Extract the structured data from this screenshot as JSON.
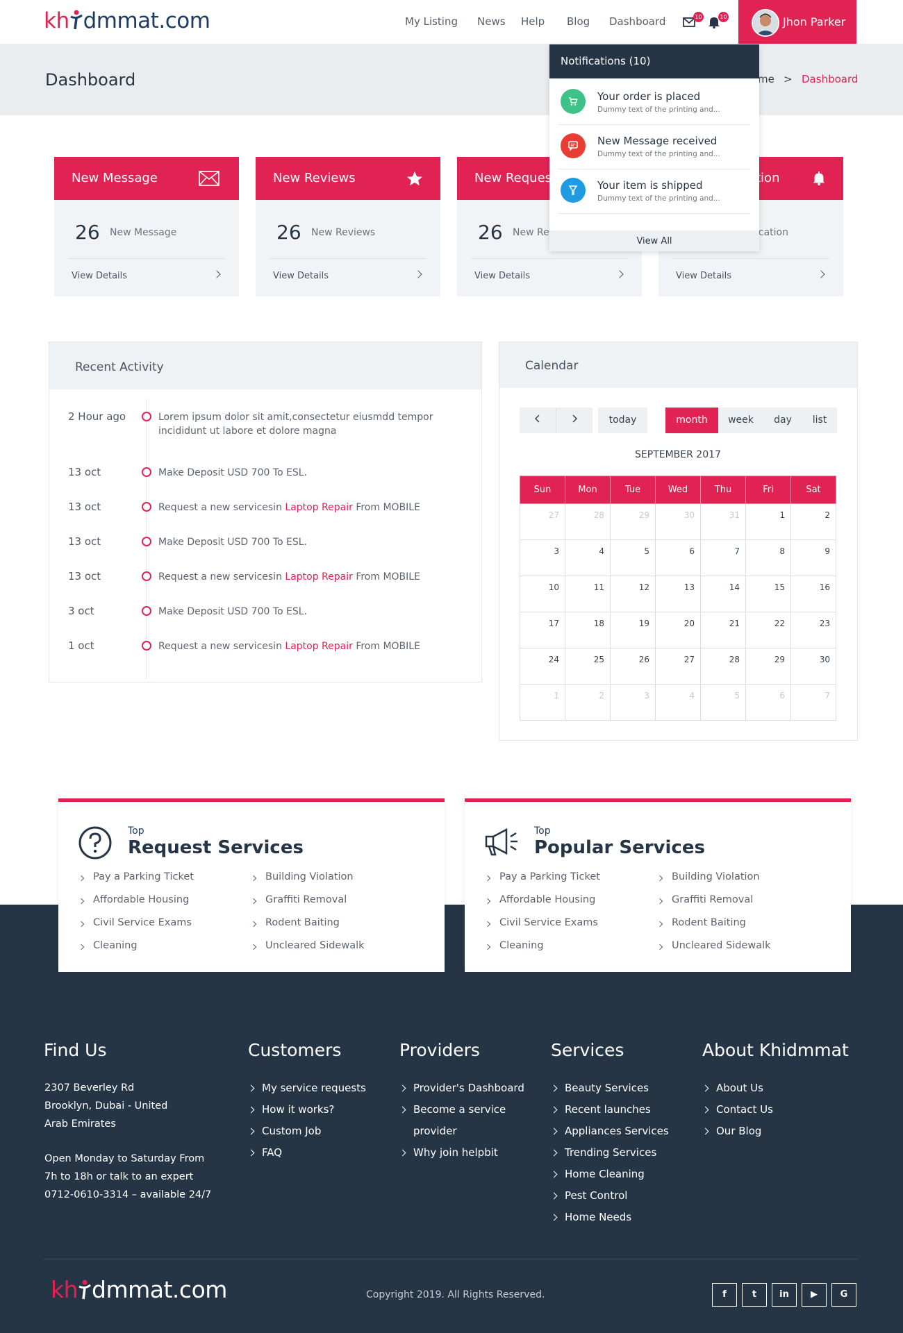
{
  "brand": {
    "logo_prefix": "kh",
    "logo_suffix": "dmmat.com"
  },
  "nav": {
    "items": [
      "My Listing",
      "News",
      "Help",
      "Blog",
      "Dashboard"
    ],
    "mail_count": "10",
    "bell_count": "10",
    "user_name": "Jhon Parker"
  },
  "page": {
    "title": "Dashboard",
    "breadcrumb_home": "me",
    "breadcrumb_sep": ">",
    "breadcrumb_current": "Dashboard"
  },
  "notifications": {
    "header": "Notifications (10)",
    "items": [
      {
        "title": "Your order is placed",
        "text": "Dummy text of the printing and...",
        "color": "#3fc287",
        "icon": "cart-icon"
      },
      {
        "title": "New Message received",
        "text": "Dummy text of the printing and...",
        "color": "#ea3b35",
        "icon": "message-icon"
      },
      {
        "title": "Your item is shipped",
        "text": "Dummy text of the printing and...",
        "color": "#1e9be3",
        "icon": "shipping-icon"
      }
    ],
    "view_all": "View All"
  },
  "cards": [
    {
      "title": "New Message",
      "count": "26",
      "label": "New Message",
      "link": "View Details",
      "icon": "envelope-icon"
    },
    {
      "title": "New Reviews",
      "count": "26",
      "label": "New Reviews",
      "link": "View Details",
      "icon": "star-icon"
    },
    {
      "title": "New Reques",
      "count": "26",
      "label": "New Re",
      "link": "View Details",
      "icon": "request-icon"
    },
    {
      "title": "tion",
      "count": "",
      "label": "ication",
      "link": "View Details",
      "icon": "bell-icon"
    }
  ],
  "activity": {
    "title": "Recent Activity",
    "items": [
      {
        "date": "2 Hour ago",
        "pre": "Lorem ipsum dolor sit amit,consectetur eiusmdd tempor incididunt ut labore et dolore magna",
        "link": "",
        "post": ""
      },
      {
        "date": "13 oct",
        "pre": "Make Deposit USD 700 To ESL.",
        "link": "",
        "post": ""
      },
      {
        "date": "13 oct",
        "pre": "Request a new servicesin ",
        "link": "Laptop Repair",
        "post": " From MOBILE"
      },
      {
        "date": "13 oct",
        "pre": "Make Deposit USD 700 To ESL.",
        "link": "",
        "post": ""
      },
      {
        "date": "13 oct",
        "pre": "Request a new servicesin ",
        "link": "Laptop Repair",
        "post": " From MOBILE"
      },
      {
        "date": "3 oct",
        "pre": "Make Deposit USD 700 To ESL.",
        "link": "",
        "post": ""
      },
      {
        "date": "1 oct",
        "pre": "Request a new servicesin ",
        "link": "Laptop Repair",
        "post": " From MOBILE"
      }
    ]
  },
  "calendar": {
    "title": "Calendar",
    "today": "today",
    "views": [
      "month",
      "week",
      "day",
      "list"
    ],
    "active_view": "month",
    "month_label": "SEPTEMBER 2017",
    "weekdays": [
      "Sun",
      "Mon",
      "Tue",
      "Wed",
      "Thu",
      "Fri",
      "Sat"
    ],
    "weeks": [
      [
        [
          "27",
          1
        ],
        [
          "28",
          1
        ],
        [
          "29",
          1
        ],
        [
          "30",
          1
        ],
        [
          "31",
          1
        ],
        [
          "1",
          0
        ],
        [
          "2",
          0
        ]
      ],
      [
        [
          "3",
          0
        ],
        [
          "4",
          0
        ],
        [
          "5",
          0
        ],
        [
          "6",
          0
        ],
        [
          "7",
          0
        ],
        [
          "8",
          0
        ],
        [
          "9",
          0
        ]
      ],
      [
        [
          "10",
          0
        ],
        [
          "11",
          0
        ],
        [
          "12",
          0
        ],
        [
          "13",
          0
        ],
        [
          "14",
          0
        ],
        [
          "15",
          0
        ],
        [
          "16",
          0
        ]
      ],
      [
        [
          "17",
          0
        ],
        [
          "18",
          0
        ],
        [
          "19",
          0
        ],
        [
          "20",
          0
        ],
        [
          "21",
          0
        ],
        [
          "22",
          0
        ],
        [
          "23",
          0
        ]
      ],
      [
        [
          "24",
          0
        ],
        [
          "25",
          0
        ],
        [
          "26",
          0
        ],
        [
          "27",
          0
        ],
        [
          "28",
          0
        ],
        [
          "29",
          0
        ],
        [
          "30",
          0
        ]
      ],
      [
        [
          "1",
          1
        ],
        [
          "2",
          1
        ],
        [
          "3",
          1
        ],
        [
          "4",
          1
        ],
        [
          "5",
          1
        ],
        [
          "6",
          1
        ],
        [
          "7",
          1
        ]
      ]
    ]
  },
  "services": [
    {
      "top": "Top",
      "title": "Request Services",
      "icon": "question-circle-icon",
      "col1": [
        "Pay a Parking Ticket",
        "Affordable Housing",
        "Civil Service Exams",
        "Cleaning"
      ],
      "col2": [
        "Building Violation",
        "Graffiti Removal",
        "Rodent Baiting",
        "Uncleared Sidewalk"
      ]
    },
    {
      "top": "Top",
      "title": "Popular Services",
      "icon": "megaphone-icon",
      "col1": [
        "Pay a Parking Ticket",
        "Affordable Housing",
        "Civil Service Exams",
        "Cleaning"
      ],
      "col2": [
        "Building Violation",
        "Graffiti Removal",
        "Rodent Baiting",
        "Uncleared Sidewalk"
      ]
    }
  ],
  "footer": {
    "find_us": {
      "title": "Find Us",
      "address": [
        "2307 Beverley Rd",
        "Brooklyn, Dubai - United",
        "Arab Emirates"
      ],
      "hours": [
        "Open Monday to Saturday From",
        "7h to 18h or talk to an expert",
        "0712-0610-3314 – available 24/7"
      ]
    },
    "customers": {
      "title": "Customers",
      "links": [
        "My service requests",
        "How it works?",
        "Custom Job",
        "FAQ"
      ]
    },
    "providers": {
      "title": "Providers",
      "links": [
        "Provider's Dashboard",
        "Become a service",
        "provider",
        "Why join helpbit"
      ]
    },
    "services": {
      "title": "Services",
      "links": [
        "Beauty Services",
        "Recent launches",
        "Appliances Services",
        "Trending Services",
        "Home Cleaning",
        "Pest Control",
        "Home Needs"
      ]
    },
    "about": {
      "title": "About Khidmmat",
      "links": [
        "About Us",
        "Contact Us",
        "Our Blog"
      ]
    },
    "copyright": "Copyright 2019. All Rights Reserved.",
    "social": [
      {
        "icon": "facebook-icon",
        "glyph": "f"
      },
      {
        "icon": "twitter-icon",
        "glyph": "t"
      },
      {
        "icon": "linkedin-icon",
        "glyph": "in"
      },
      {
        "icon": "youtube-icon",
        "glyph": "▶"
      },
      {
        "icon": "google-icon",
        "glyph": "G"
      }
    ]
  },
  "colors": {
    "accent": "#e02352",
    "dark": "#263546",
    "light_panel": "#eff2f5"
  }
}
